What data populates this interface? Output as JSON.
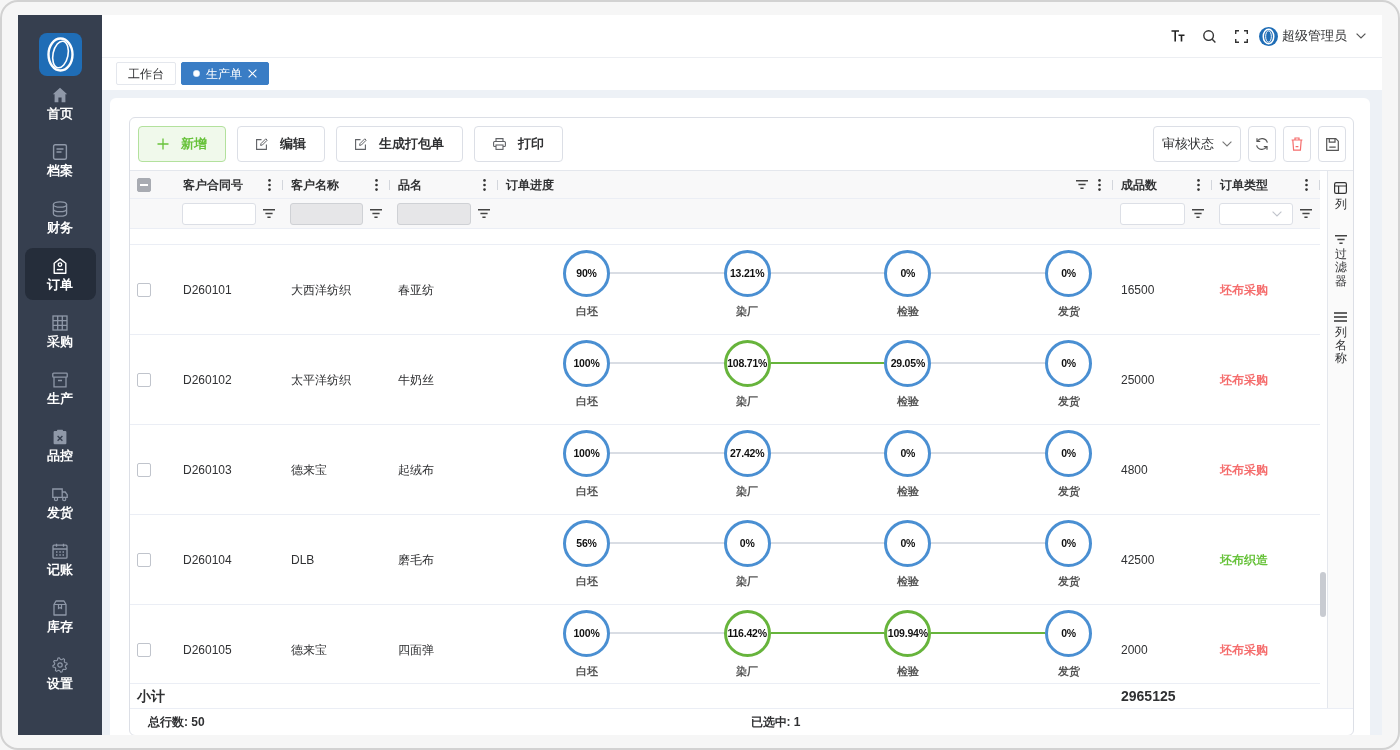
{
  "sidebar": {
    "items": [
      {
        "label": "首页",
        "selected": false
      },
      {
        "label": "档案",
        "selected": false
      },
      {
        "label": "财务",
        "selected": false
      },
      {
        "label": "订单",
        "selected": true
      },
      {
        "label": "采购",
        "selected": false
      },
      {
        "label": "生产",
        "selected": false
      },
      {
        "label": "品控",
        "selected": false
      },
      {
        "label": "发货",
        "selected": false
      },
      {
        "label": "记账",
        "selected": false
      },
      {
        "label": "库存",
        "selected": false
      },
      {
        "label": "设置",
        "selected": false
      }
    ]
  },
  "header": {
    "user_name": "超级管理员"
  },
  "tabs": [
    {
      "label": "工作台",
      "selected": false,
      "closable": false
    },
    {
      "label": "生产单",
      "selected": true,
      "closable": true
    }
  ],
  "toolbar": {
    "buttons": [
      {
        "label": "新增",
        "kind": "add"
      },
      {
        "label": "编辑",
        "kind": "edit"
      },
      {
        "label": "生成打包单",
        "kind": "edit"
      },
      {
        "label": "打印",
        "kind": "print"
      }
    ],
    "status_filter": {
      "label": "审核状态"
    }
  },
  "table": {
    "select_all": {
      "indeterminate": true
    },
    "columns": [
      {
        "label": "客户合同号",
        "filter": {
          "kind": "input",
          "disabled": false
        }
      },
      {
        "label": "客户名称",
        "filter": {
          "kind": "input",
          "disabled": true
        }
      },
      {
        "label": "品名",
        "filter": {
          "kind": "input",
          "disabled": true
        }
      },
      {
        "label": "订单进度"
      },
      {
        "label": "成品数",
        "filter": {
          "kind": "input",
          "disabled": false
        }
      },
      {
        "label": "订单类型",
        "filter": {
          "kind": "select",
          "disabled": false
        }
      }
    ],
    "rows": [
      {
        "selected": false,
        "contract_no": "D260101",
        "customer": "大西洋纺织",
        "product": "春亚纺",
        "progress": [
          {
            "label": "白坯",
            "value": "90%",
            "highlighted": false
          },
          {
            "label": "染厂",
            "value": "13.21%",
            "highlighted": false
          },
          {
            "label": "检验",
            "value": "0%",
            "highlighted": false
          },
          {
            "label": "发货",
            "value": "0%",
            "highlighted": false
          }
        ],
        "quantity": "16500",
        "order_type": {
          "text": "坯布采购",
          "color": "#f56c6c"
        }
      },
      {
        "selected": false,
        "contract_no": "D260102",
        "customer": "太平洋纺织",
        "product": "牛奶丝",
        "progress": [
          {
            "label": "白坯",
            "value": "100%",
            "highlighted": false
          },
          {
            "label": "染厂",
            "value": "108.71%",
            "highlighted": true
          },
          {
            "label": "检验",
            "value": "29.05%",
            "highlighted": false
          },
          {
            "label": "发货",
            "value": "0%",
            "highlighted": false
          }
        ],
        "quantity": "25000",
        "order_type": {
          "text": "坯布采购",
          "color": "#f56c6c"
        }
      },
      {
        "selected": false,
        "contract_no": "D260103",
        "customer": "德来宝",
        "product": "起绒布",
        "progress": [
          {
            "label": "白坯",
            "value": "100%",
            "highlighted": false
          },
          {
            "label": "染厂",
            "value": "27.42%",
            "highlighted": false
          },
          {
            "label": "检验",
            "value": "0%",
            "highlighted": false
          },
          {
            "label": "发货",
            "value": "0%",
            "highlighted": false
          }
        ],
        "quantity": "4800",
        "order_type": {
          "text": "坯布采购",
          "color": "#f56c6c"
        }
      },
      {
        "selected": false,
        "contract_no": "D260104",
        "customer": "DLB",
        "product": "磨毛布",
        "progress": [
          {
            "label": "白坯",
            "value": "56%",
            "highlighted": false
          },
          {
            "label": "染厂",
            "value": "0%",
            "highlighted": false
          },
          {
            "label": "检验",
            "value": "0%",
            "highlighted": false
          },
          {
            "label": "发货",
            "value": "0%",
            "highlighted": false
          }
        ],
        "quantity": "42500",
        "order_type": {
          "text": "坯布织造",
          "color": "#67c23a"
        }
      },
      {
        "selected": false,
        "contract_no": "D260105",
        "customer": "德来宝",
        "product": "四面弹",
        "progress": [
          {
            "label": "白坯",
            "value": "100%",
            "highlighted": false
          },
          {
            "label": "染厂",
            "value": "116.42%",
            "highlighted": true
          },
          {
            "label": "检验",
            "value": "109.94%",
            "highlighted": true
          },
          {
            "label": "发货",
            "value": "0%",
            "highlighted": false
          }
        ],
        "quantity": "2000",
        "order_type": {
          "text": "坯布采购",
          "color": "#f56c6c"
        }
      }
    ],
    "summary": {
      "label": "小计",
      "quantity": "2965125"
    }
  },
  "side_panel": {
    "items": [
      {
        "label": "列"
      },
      {
        "label": "过滤器"
      },
      {
        "label": "列名称"
      }
    ]
  },
  "status_bar": {
    "total_rows": "总行数: 50",
    "selected_count": "已选中: 1"
  }
}
